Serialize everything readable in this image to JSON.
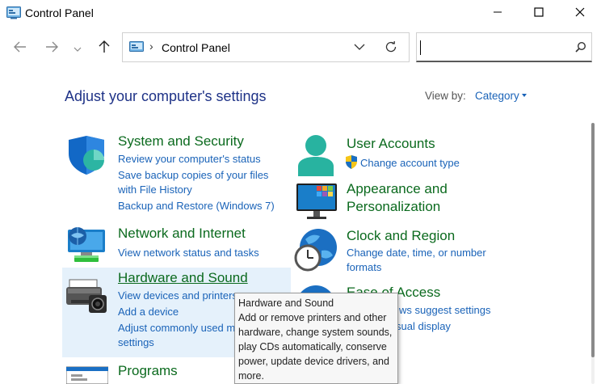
{
  "window": {
    "title": "Control Panel"
  },
  "address": {
    "path": "Control Panel",
    "separator": "›",
    "search_value": ""
  },
  "header": {
    "heading": "Adjust your computer's settings",
    "viewby_label": "View by:",
    "viewby_value": "Category"
  },
  "categories": {
    "system": {
      "title": "System and Security",
      "links": [
        "Review your computer's status",
        "Save backup copies of your files",
        "with File History",
        "Backup and Restore (Windows 7)"
      ]
    },
    "network": {
      "title": "Network and Internet",
      "links": [
        "View network status and tasks"
      ]
    },
    "hardware": {
      "title": "Hardware and Sound",
      "links": [
        "View devices and printers",
        "Add a device",
        "Adjust commonly used m",
        "settings"
      ]
    },
    "programs": {
      "title": "Programs"
    },
    "users": {
      "title": "User Accounts",
      "links": [
        "Change account type"
      ]
    },
    "appearance": {
      "title_line1": "Appearance and",
      "title_line2": "Personalization"
    },
    "clock": {
      "title": "Clock and Region",
      "links": [
        "Change date, time, or number",
        "formats"
      ]
    },
    "ease": {
      "title": "Ease of Access",
      "links": [
        "ws suggest settings",
        "sual display"
      ]
    }
  },
  "tooltip": {
    "lines": [
      "Hardware and Sound",
      "Add or remove printers and other",
      "hardware, change system sounds,",
      "play CDs automatically, conserve",
      "power, update device drivers, and",
      "more."
    ]
  },
  "colors": {
    "heading": "#1e3287",
    "category_title": "#0b6a1e",
    "link": "#1a63b8",
    "hover": "#e5f1fb"
  },
  "icons": [
    "control-panel-icon",
    "minimize-icon",
    "maximize-icon",
    "close-icon",
    "back-arrow-icon",
    "forward-arrow-icon",
    "recent-chevron-icon",
    "up-arrow-icon",
    "dropdown-chevron-icon",
    "refresh-icon",
    "search-icon",
    "shield-icon",
    "network-icon",
    "printer-icon",
    "programs-icon",
    "user-icon",
    "uac-shield-icon",
    "monitor-icon",
    "clock-globe-icon",
    "ease-of-access-icon"
  ]
}
